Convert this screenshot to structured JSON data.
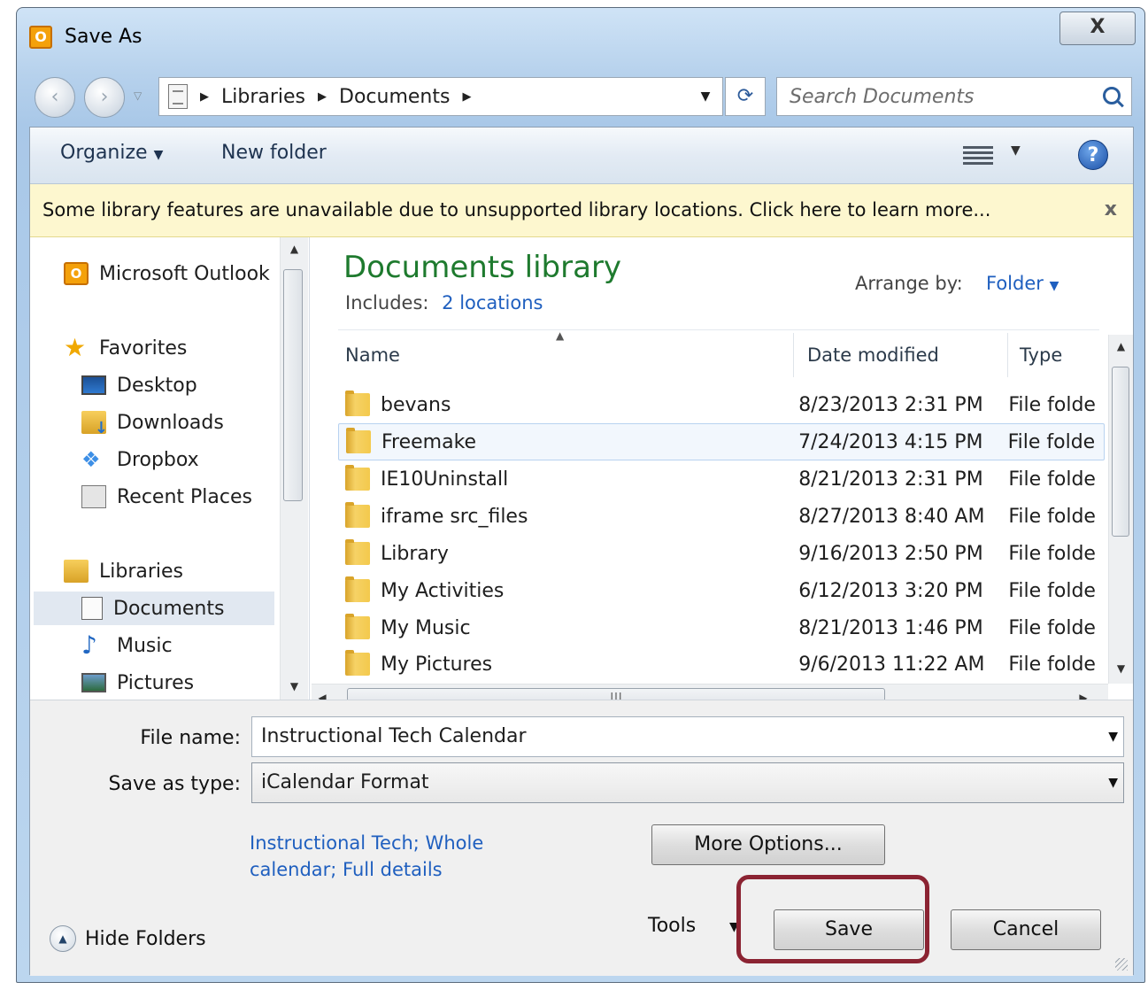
{
  "window": {
    "title": "Save As",
    "close_label": "X"
  },
  "address": {
    "crumbs": [
      "Libraries",
      "Documents"
    ],
    "search_placeholder": "Search Documents"
  },
  "toolbar": {
    "organize": "Organize",
    "new_folder": "New folder",
    "help": "?"
  },
  "infobar": {
    "message": "Some library features are unavailable due to unsupported library locations. Click here to learn more...",
    "close": "x"
  },
  "nav": {
    "top_item": "Microsoft Outlook",
    "favorites": {
      "label": "Favorites",
      "items": [
        "Desktop",
        "Downloads",
        "Dropbox",
        "Recent Places"
      ]
    },
    "libraries": {
      "label": "Libraries",
      "items": [
        "Documents",
        "Music",
        "Pictures"
      ]
    },
    "selected": "Documents"
  },
  "library": {
    "title": "Documents library",
    "includes_label": "Includes:",
    "includes_link": "2 locations",
    "arrange_label": "Arrange by:",
    "arrange_value": "Folder"
  },
  "columns": {
    "name": "Name",
    "date": "Date modified",
    "type": "Type"
  },
  "files": [
    {
      "name": "bevans",
      "date": "8/23/2013 2:31 PM",
      "type": "File folde"
    },
    {
      "name": "Freemake",
      "date": "7/24/2013 4:15 PM",
      "type": "File folde"
    },
    {
      "name": "IE10Uninstall",
      "date": "8/21/2013 2:31 PM",
      "type": "File folde"
    },
    {
      "name": "iframe src_files",
      "date": "8/27/2013 8:40 AM",
      "type": "File folde"
    },
    {
      "name": "Library",
      "date": "9/16/2013 2:50 PM",
      "type": "File folde"
    },
    {
      "name": "My Activities",
      "date": "6/12/2013 3:20 PM",
      "type": "File folde"
    },
    {
      "name": "My Music",
      "date": "8/21/2013 1:46 PM",
      "type": "File folde"
    },
    {
      "name": "My Pictures",
      "date": "9/6/2013 11:22 AM",
      "type": "File folde"
    }
  ],
  "form": {
    "file_name_label": "File name:",
    "file_name_value": "Instructional Tech Calendar",
    "save_type_label": "Save as type:",
    "save_type_value": "iCalendar Format",
    "details_link": "Instructional Tech; Whole calendar; Full details",
    "more_options": "More Options...",
    "tools": "Tools",
    "save": "Save",
    "cancel": "Cancel",
    "hide_folders": "Hide Folders"
  },
  "colors": {
    "accent_highlight": "#8b2332",
    "library_title": "#1e7a2e",
    "link": "#1f5fbf"
  }
}
